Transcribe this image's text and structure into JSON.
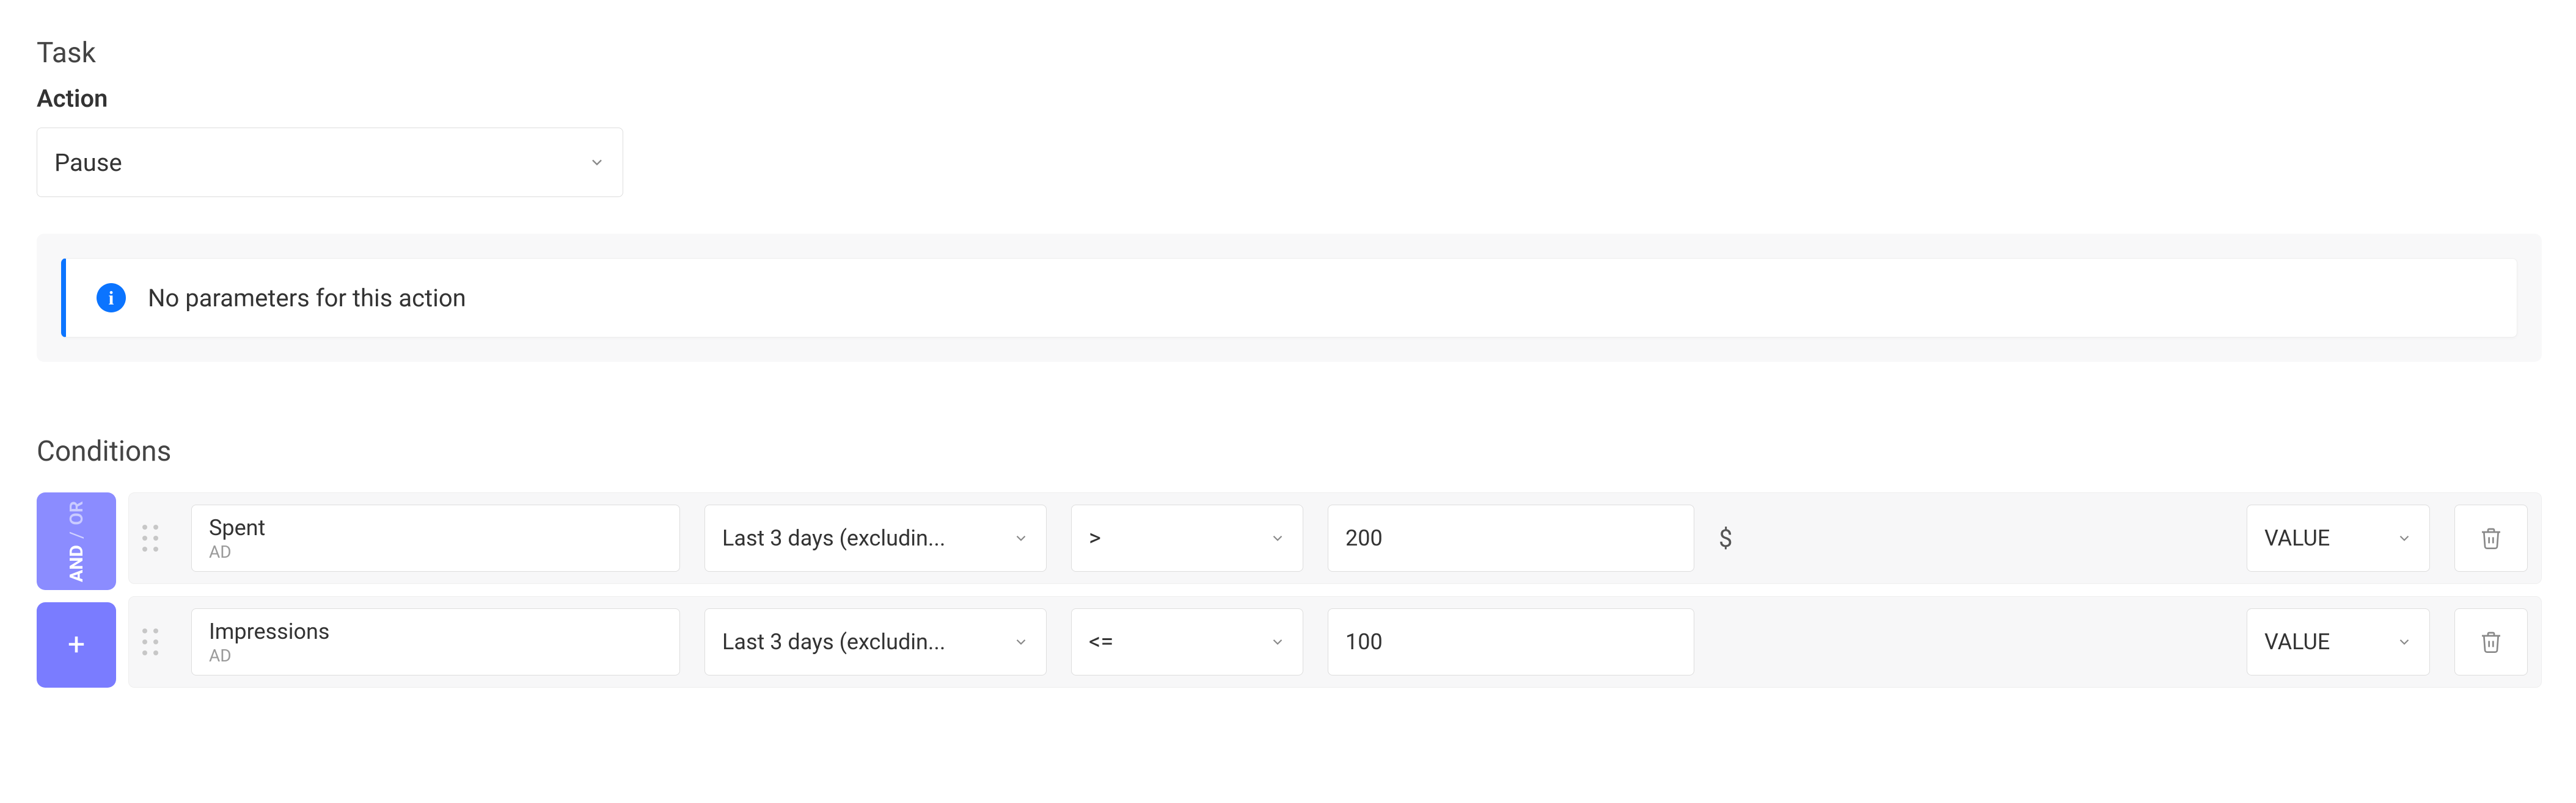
{
  "task": {
    "section_title": "Task",
    "action_label": "Action",
    "action_value": "Pause",
    "info_message": "No parameters for this action"
  },
  "conditions": {
    "section_title": "Conditions",
    "logic": {
      "and": "AND",
      "or": "OR"
    },
    "add_symbol": "+",
    "rows": [
      {
        "metric": "Spent",
        "metric_sub": "AD",
        "period": "Last 3 days (excludin...",
        "operator": ">",
        "value": "200",
        "unit": "$",
        "type": "VALUE"
      },
      {
        "metric": "Impressions",
        "metric_sub": "AD",
        "period": "Last 3 days (excludin...",
        "operator": "<=",
        "value": "100",
        "unit": "",
        "type": "VALUE"
      }
    ]
  }
}
